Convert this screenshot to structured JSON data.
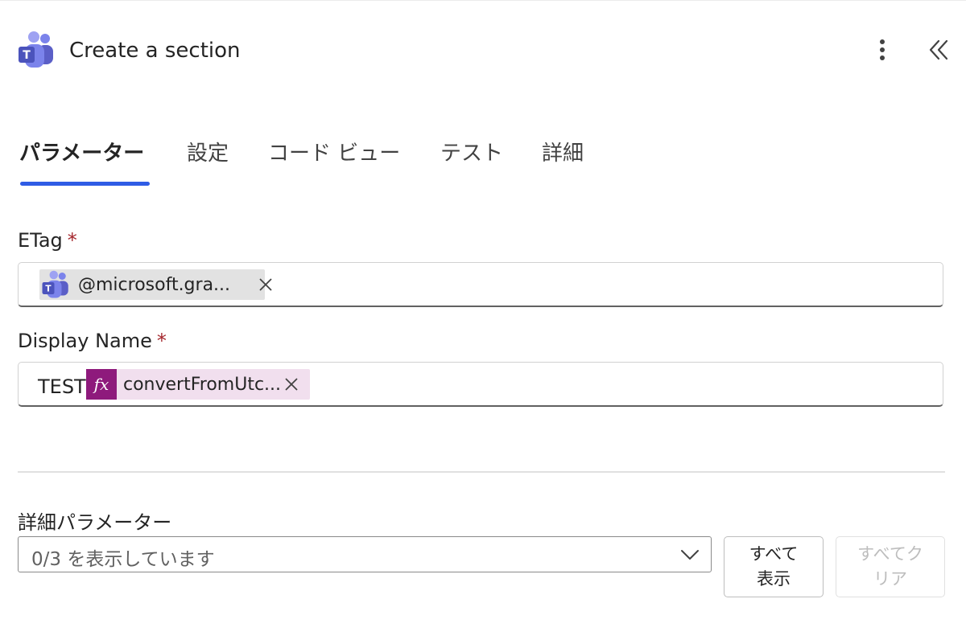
{
  "header": {
    "title": "Create a section",
    "app_icon": "teams-icon",
    "more_icon": "more-vertical-icon",
    "collapse_icon": "double-chevron-left-icon"
  },
  "tabs": [
    {
      "label": "パラメーター",
      "active": true
    },
    {
      "label": "設定",
      "active": false
    },
    {
      "label": "コード ビュー",
      "active": false
    },
    {
      "label": "テスト",
      "active": false
    },
    {
      "label": "詳細",
      "active": false
    }
  ],
  "fields": {
    "etag": {
      "label": "ETag",
      "required_mark": "*",
      "token": {
        "text": "@microsoft.gra...",
        "icon": "teams-icon"
      }
    },
    "display_name": {
      "label": "Display Name",
      "required_mark": "*",
      "prefix_text": "TEST",
      "token": {
        "text": "convertFromUtc...",
        "icon": "fx-icon",
        "badge": "fx"
      }
    }
  },
  "advanced": {
    "label": "詳細パラメーター",
    "dropdown_value": "0/3 を表示しています",
    "show_all_line1": "すべて",
    "show_all_line2": "表示",
    "clear_all_line1": "すべてク",
    "clear_all_line2": "リア"
  },
  "colors": {
    "accent": "#2f5ce5",
    "fx_badge": "#8e1a7c",
    "fx_token_bg": "#f1dfee",
    "teams_token_bg": "#e2e2e2",
    "required": "#a4262c",
    "disabled_text": "#bdbdbd"
  }
}
